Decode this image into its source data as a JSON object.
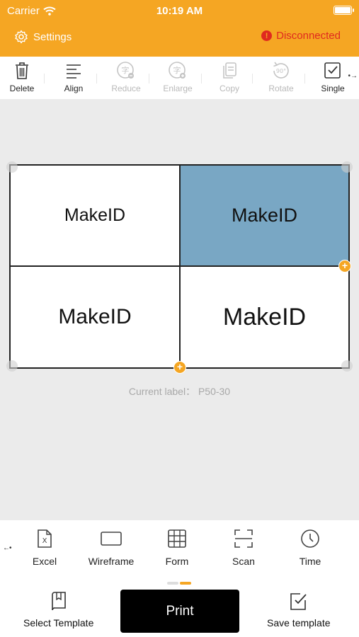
{
  "status": {
    "carrier": "Carrier",
    "time": "10:19 AM"
  },
  "nav": {
    "settings_label": "Settings",
    "connection_status": "Disconnected",
    "accent": "#f5a623",
    "error_color": "#e02a1f"
  },
  "toolbar": {
    "items": [
      {
        "label": "Delete",
        "icon": "trash-icon",
        "enabled": true
      },
      {
        "label": "Align",
        "icon": "align-icon",
        "enabled": true
      },
      {
        "label": "Reduce",
        "icon": "text-reduce-icon",
        "enabled": false
      },
      {
        "label": "Enlarge",
        "icon": "text-enlarge-icon",
        "enabled": false
      },
      {
        "label": "Copy",
        "icon": "copy-icon",
        "enabled": false
      },
      {
        "label": "Rotate",
        "icon": "rotate-90-icon",
        "enabled": false
      },
      {
        "label": "Single",
        "icon": "checkbox-icon",
        "enabled": true
      }
    ],
    "scroll_hint": "•→"
  },
  "canvas": {
    "cells": [
      {
        "text": "MakeID",
        "selected": false
      },
      {
        "text": "MakeID",
        "selected": true
      },
      {
        "text": "MakeID",
        "selected": false
      },
      {
        "text": "MakeID",
        "selected": false
      }
    ],
    "selected_color": "#79a7c4",
    "current_label": "Current label： P50-30"
  },
  "functions": {
    "scroll_hint": "←•",
    "items": [
      {
        "label": "Excel",
        "icon": "excel-file-icon"
      },
      {
        "label": "Wireframe",
        "icon": "rectangle-icon"
      },
      {
        "label": "Form",
        "icon": "table-grid-icon"
      },
      {
        "label": "Scan",
        "icon": "scan-icon"
      },
      {
        "label": "Time",
        "icon": "clock-icon"
      }
    ]
  },
  "bottom": {
    "select_template_label": "Select Template",
    "print_label": "Print",
    "save_template_label": "Save template"
  }
}
